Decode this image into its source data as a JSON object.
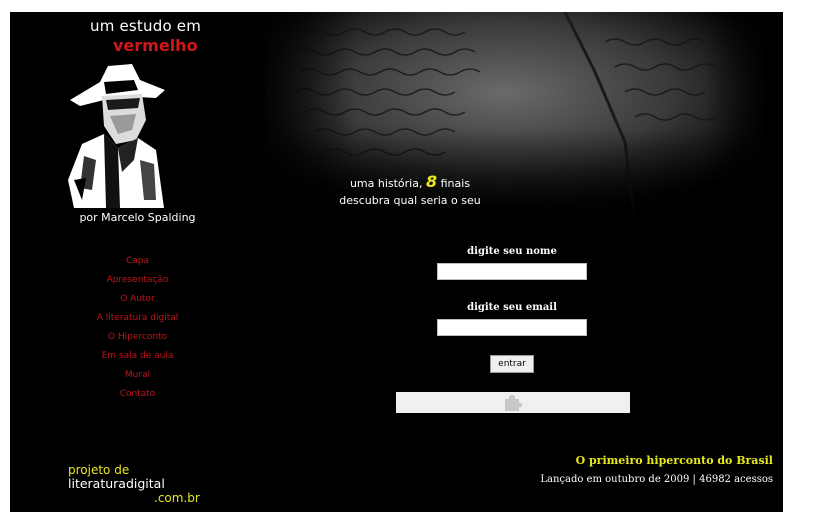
{
  "brand": {
    "title_line1": "um estudo em",
    "title_line2": "vermelho",
    "author": "por Marcelo Spalding"
  },
  "nav": {
    "items": [
      "Capa",
      "Apresentação",
      "O Autor",
      "A literatura digital",
      "O Hiperconto",
      "Em sala de aula",
      "Mural",
      "Contato"
    ]
  },
  "hero": {
    "tagline_prefix": "uma história,",
    "tagline_number": "8",
    "tagline_suffix": "finais",
    "tagline_line2": "descubra qual seria o seu"
  },
  "form": {
    "name_label": "digite seu nome",
    "name_value": "",
    "email_label": "digite seu email",
    "email_value": "",
    "submit_label": "entrar"
  },
  "footer": {
    "logo_line1": "projeto de",
    "logo_line2": "literaturadigital",
    "logo_line3": ".com.br",
    "headline": "O primeiro hiperconto do Brasil",
    "info": "Lançado em outubro de 2009 | 46982 acessos"
  },
  "colors": {
    "background": "#000000",
    "accent_red": "#d01818",
    "nav_red": "#c0141a",
    "accent_yellow": "#e8e81e",
    "text_white": "#ffffff"
  },
  "icons": {
    "plugin": "puzzle-piece-icon",
    "illustration": "detective-illustration"
  }
}
